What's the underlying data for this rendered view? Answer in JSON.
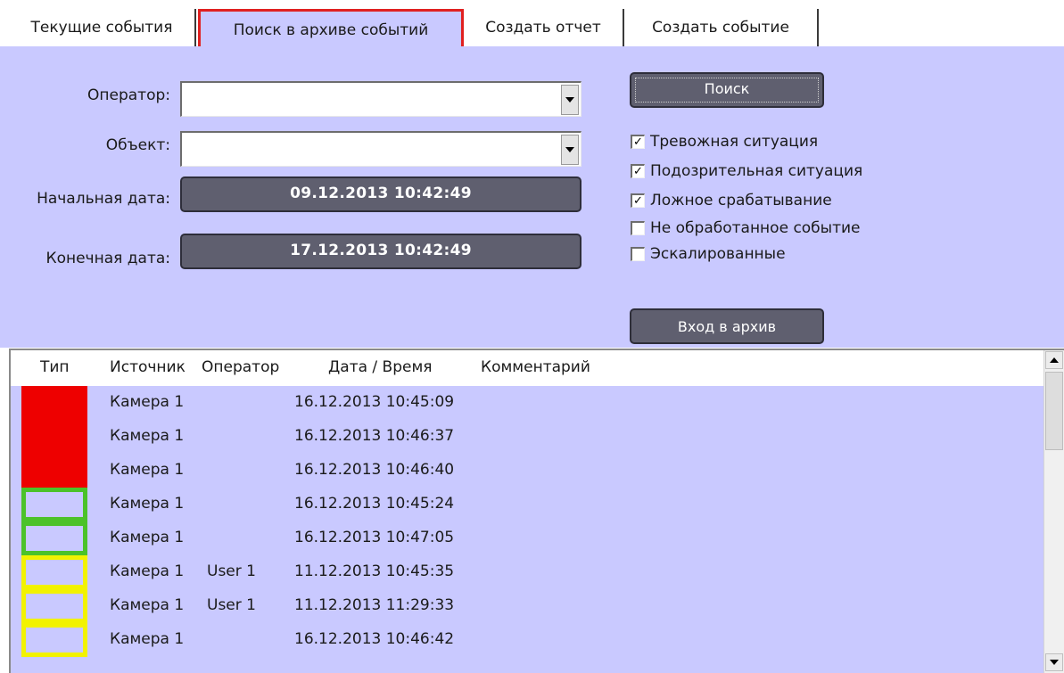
{
  "tabs": [
    {
      "label": "Текущие события"
    },
    {
      "label": "Поиск в архиве событий"
    },
    {
      "label": "Создать отчет"
    },
    {
      "label": "Создать событие"
    }
  ],
  "search": {
    "operator_label": "Оператор:",
    "operator_value": "",
    "object_label": "Объект:",
    "object_value": "",
    "start_label": "Начальная дата:",
    "start_value": "09.12.2013 10:42:49",
    "end_label": "Конечная дата:",
    "end_value": "17.12.2013 10:42:49",
    "search_button": "Поиск",
    "archive_button": "Вход в архив"
  },
  "filters": [
    {
      "label": "Тревожная ситуация",
      "checked": true,
      "mark": "✓"
    },
    {
      "label": "Подозрительная ситуация",
      "checked": true,
      "mark": "✓"
    },
    {
      "label": "Ложное срабатывание",
      "checked": true,
      "mark": "✓"
    },
    {
      "label": "Не обработанное событие",
      "checked": false,
      "mark": ""
    },
    {
      "label": "Эскалированные",
      "checked": false,
      "mark": ""
    }
  ],
  "events": {
    "columns": {
      "type": "Тип",
      "source": "Источник",
      "operator": "Оператор",
      "datetime": "Дата / Время",
      "comment": "Комментарий"
    },
    "rows": [
      {
        "type": "red",
        "source": "Камера 1",
        "operator": "",
        "datetime": "16.12.2013 10:45:09",
        "comment": ""
      },
      {
        "type": "red",
        "source": "Камера 1",
        "operator": "",
        "datetime": "16.12.2013 10:46:37",
        "comment": ""
      },
      {
        "type": "red",
        "source": "Камера 1",
        "operator": "",
        "datetime": "16.12.2013 10:46:40",
        "comment": ""
      },
      {
        "type": "green",
        "source": "Камера 1",
        "operator": "",
        "datetime": "16.12.2013 10:45:24",
        "comment": ""
      },
      {
        "type": "green",
        "source": "Камера 1",
        "operator": "",
        "datetime": "16.12.2013 10:47:05",
        "comment": ""
      },
      {
        "type": "yellow",
        "source": "Камера 1",
        "operator": "User 1",
        "datetime": "11.12.2013 10:45:35",
        "comment": ""
      },
      {
        "type": "yellow",
        "source": "Камера 1",
        "operator": "User 1",
        "datetime": "11.12.2013 11:29:33",
        "comment": ""
      },
      {
        "type": "yellow",
        "source": "Камера 1",
        "operator": "",
        "datetime": "16.12.2013 10:46:42",
        "comment": ""
      }
    ]
  },
  "colors": {
    "panel_bg": "#c9c9ff",
    "dark_button": "#5f5f6f",
    "active_tab_border": "#e02020",
    "type_red": "#ee0000",
    "type_green": "#4cc22a",
    "type_yellow": "#f2f200"
  },
  "icons": {
    "dropdown": "chevron-down-icon",
    "checkbox": "checkmark-icon",
    "scroll_up": "arrow-up-icon",
    "scroll_down": "arrow-down-icon"
  }
}
